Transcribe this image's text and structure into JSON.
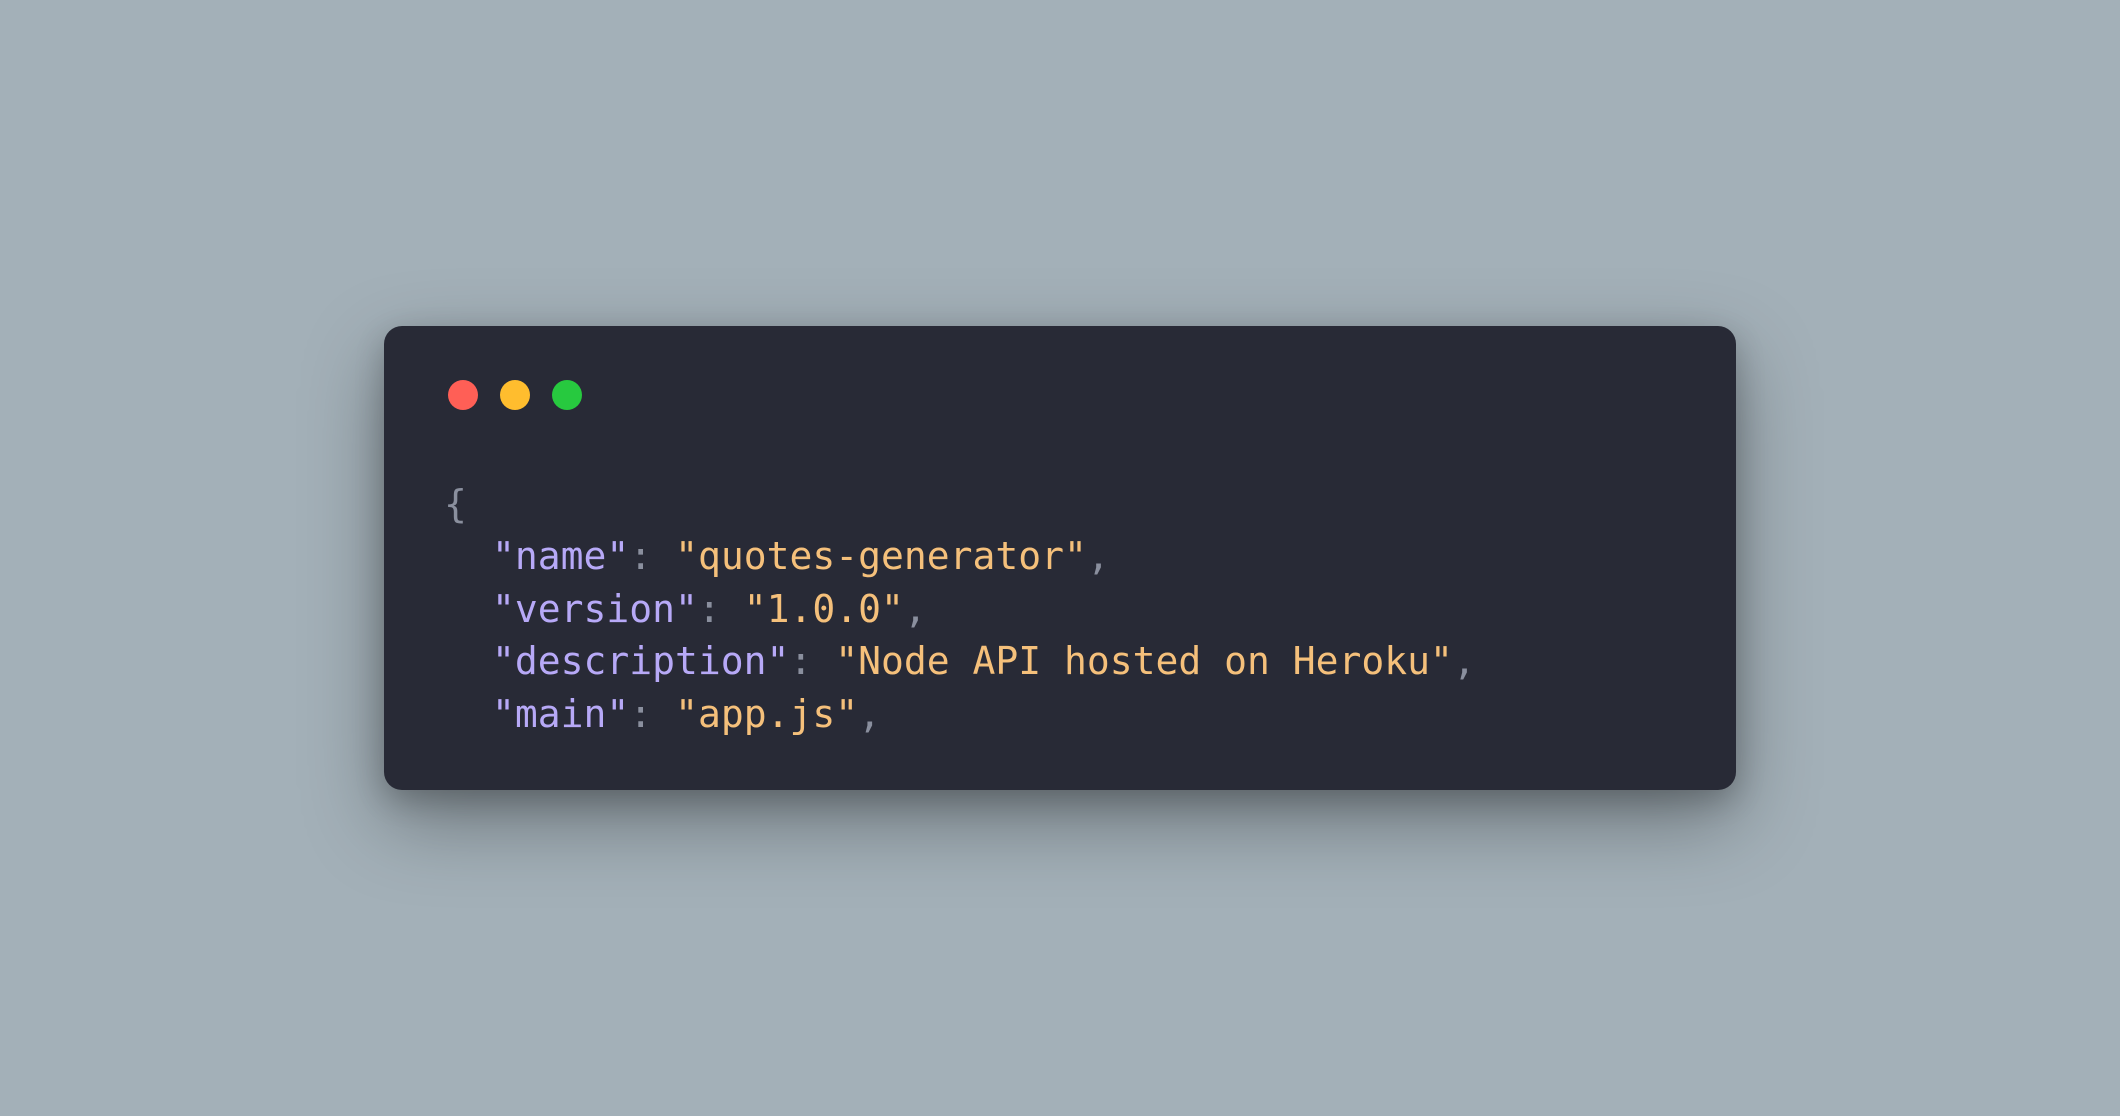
{
  "colors": {
    "close": "#ff5f56",
    "minimize": "#ffbd2e",
    "maximize": "#27c93f"
  },
  "code": {
    "brace_open": "{",
    "lines": [
      {
        "key": "\"name\"",
        "value": "\"quotes-generator\""
      },
      {
        "key": "\"version\"",
        "value": "\"1.0.0\""
      },
      {
        "key": "\"description\"",
        "value": "\"Node API hosted on Heroku\""
      },
      {
        "key": "\"main\"",
        "value": "\"app.js\""
      }
    ],
    "colon": ":",
    "comma": ","
  }
}
